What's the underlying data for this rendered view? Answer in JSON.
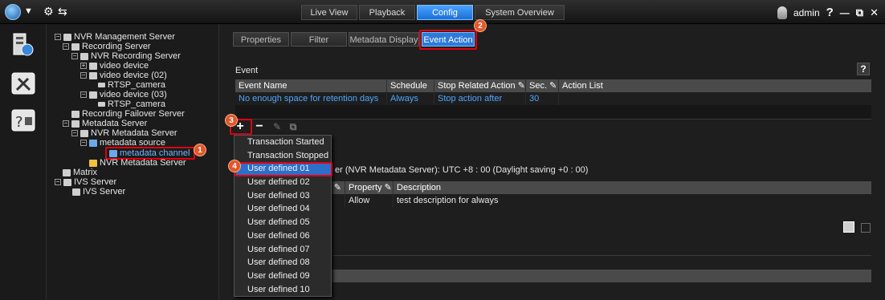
{
  "topbar": {
    "tabs": [
      {
        "label": "Live View"
      },
      {
        "label": "Playback"
      },
      {
        "label": "Config"
      },
      {
        "label": "System Overview"
      }
    ],
    "active_tab": "Config",
    "user": "admin",
    "help": "?",
    "minimize": "—",
    "restore": "⧉",
    "close": "✕"
  },
  "tree": {
    "items": [
      {
        "label": "NVR Management Server"
      },
      {
        "label": "Recording Server"
      },
      {
        "label": "NVR Recording Server"
      },
      {
        "label": "video device"
      },
      {
        "label": "video device (02)"
      },
      {
        "label": "RTSP_camera"
      },
      {
        "label": "video device (03)"
      },
      {
        "label": "RTSP_camera"
      },
      {
        "label": "Recording Failover Server"
      },
      {
        "label": "Metadata Server"
      },
      {
        "label": "NVR Metadata Server"
      },
      {
        "label": "metadata source"
      },
      {
        "label": "metadata channel"
      },
      {
        "label": "NVR Metadata Server"
      },
      {
        "label": "Matrix"
      },
      {
        "label": "IVS Server"
      },
      {
        "label": "IVS Server"
      }
    ]
  },
  "subtabs": [
    {
      "label": "Properties"
    },
    {
      "label": "Filter"
    },
    {
      "label": "Metadata Display"
    },
    {
      "label": "Event Action"
    }
  ],
  "event": {
    "title": "Event",
    "help": "?",
    "columns": [
      "Event Name",
      "Schedule",
      "Stop Related Action",
      "Sec.",
      "Action List"
    ],
    "rows": [
      {
        "name": "No enough space for retention days",
        "schedule": "Always",
        "stop_action": "Stop action after",
        "sec": "30",
        "action_list": ""
      }
    ]
  },
  "schedule": {
    "timezone_text": "er (NVR Metadata Server): UTC +8 : 00  (Daylight saving +0 : 00)",
    "columns": [
      "Property",
      "Description"
    ],
    "rows": [
      {
        "property": "Allow",
        "description": "test description for always"
      }
    ]
  },
  "dropdown": {
    "items": [
      "Transaction Started",
      "Transaction Stopped",
      "User defined 01",
      "User defined 02",
      "User defined 03",
      "User defined 04",
      "User defined 05",
      "User defined 06",
      "User defined 07",
      "User defined 08",
      "User defined 09",
      "User defined 10"
    ],
    "highlighted": "User defined 01"
  },
  "callouts": [
    "1",
    "2",
    "3",
    "4"
  ],
  "colors": {
    "accent": "#2d7ad8",
    "link_text": "#4ea6ff",
    "callout": "#e0572b",
    "highlight_box": "#e00010"
  }
}
